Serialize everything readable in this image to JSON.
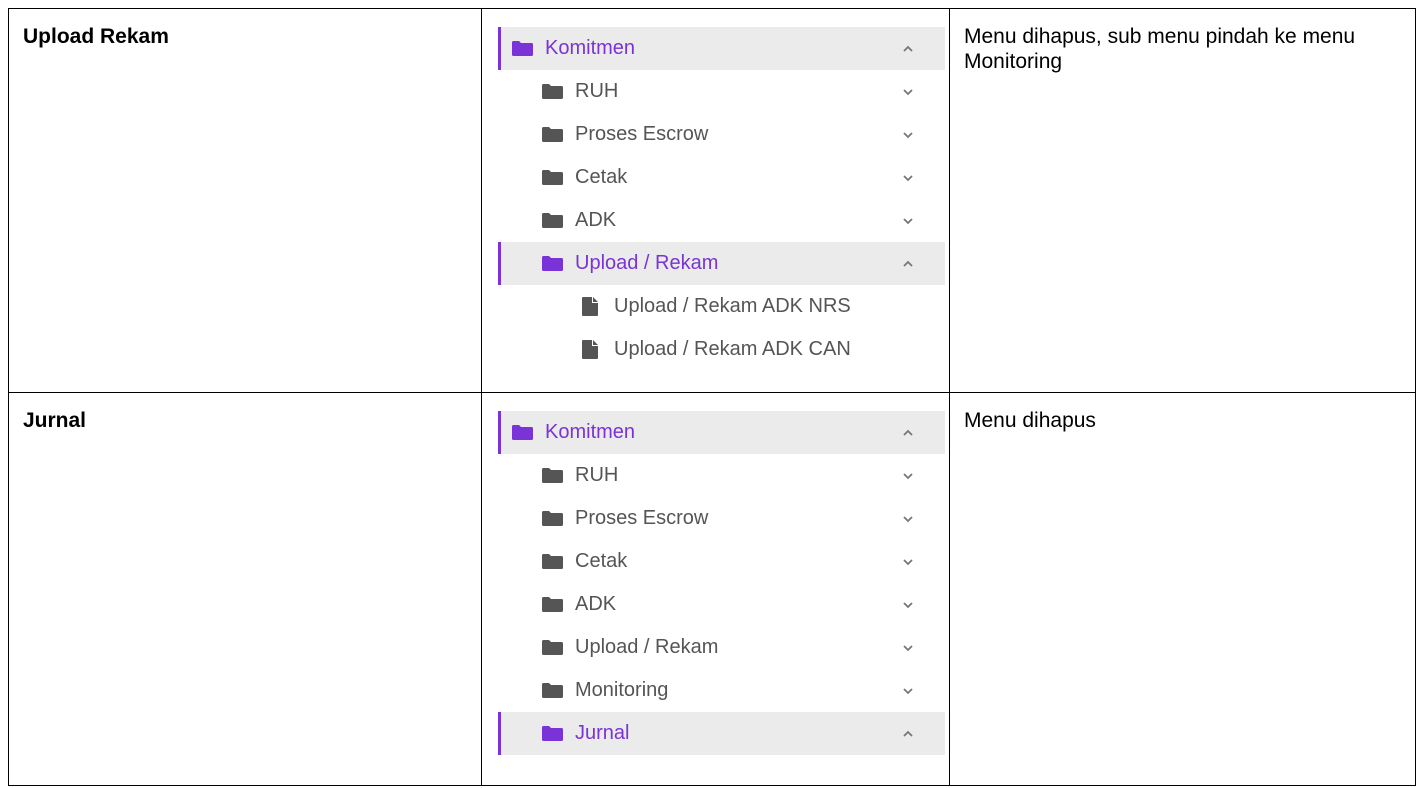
{
  "colors": {
    "accent": "#7a33d6",
    "muted": "#555555",
    "active_bg": "#ebebeb"
  },
  "rows": [
    {
      "label": "Upload Rekam",
      "note": "Menu dihapus, sub menu pindah ke menu Monitoring",
      "menu": [
        {
          "label": "Komitmen",
          "icon": "folder-icon",
          "chevron": "chevron-up-icon",
          "active": true
        },
        {
          "label": "RUH",
          "icon": "folder-icon",
          "chevron": "chevron-down-icon",
          "active": false
        },
        {
          "label": "Proses Escrow",
          "icon": "folder-icon",
          "chevron": "chevron-down-icon",
          "active": false
        },
        {
          "label": "Cetak",
          "icon": "folder-icon",
          "chevron": "chevron-down-icon",
          "active": false
        },
        {
          "label": "ADK",
          "icon": "folder-icon",
          "chevron": "chevron-down-icon",
          "active": false
        },
        {
          "label": "Upload / Rekam",
          "icon": "folder-icon",
          "chevron": "chevron-up-icon",
          "active": true
        },
        {
          "label": "Upload / Rekam ADK NRS",
          "icon": "file-icon"
        },
        {
          "label": "Upload / Rekam ADK CAN",
          "icon": "file-icon"
        }
      ]
    },
    {
      "label": "Jurnal",
      "note": "Menu dihapus",
      "menu": [
        {
          "label": "Komitmen",
          "icon": "folder-icon",
          "chevron": "chevron-up-icon",
          "active": true
        },
        {
          "label": "RUH",
          "icon": "folder-icon",
          "chevron": "chevron-down-icon",
          "active": false
        },
        {
          "label": "Proses Escrow",
          "icon": "folder-icon",
          "chevron": "chevron-down-icon",
          "active": false
        },
        {
          "label": "Cetak",
          "icon": "folder-icon",
          "chevron": "chevron-down-icon",
          "active": false
        },
        {
          "label": "ADK",
          "icon": "folder-icon",
          "chevron": "chevron-down-icon",
          "active": false
        },
        {
          "label": "Upload / Rekam",
          "icon": "folder-icon",
          "chevron": "chevron-down-icon",
          "active": false
        },
        {
          "label": "Monitoring",
          "icon": "folder-icon",
          "chevron": "chevron-down-icon",
          "active": false
        },
        {
          "label": "Jurnal",
          "icon": "folder-icon",
          "chevron": "chevron-up-icon",
          "active": true
        }
      ]
    }
  ]
}
